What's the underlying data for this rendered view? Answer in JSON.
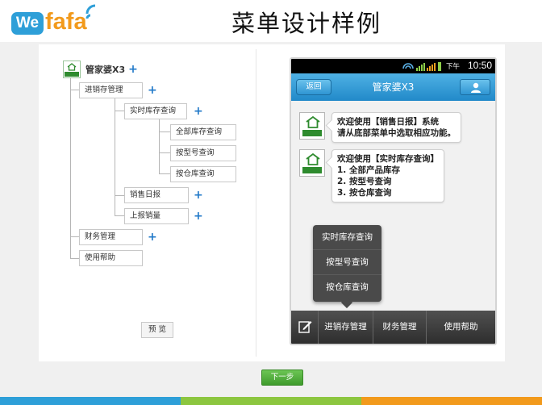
{
  "header": {
    "logo_we": "We",
    "logo_fafa": "fafa",
    "title": "菜单设计样例"
  },
  "editor": {
    "root_name": "管家婆X3",
    "menu_tree": [
      {
        "label": "进销存管理"
      },
      {
        "label": "实时库存查询"
      },
      {
        "label": "全部库存查询"
      },
      {
        "label": "按型号查询"
      },
      {
        "label": "按仓库查询"
      },
      {
        "label": "销售日报"
      },
      {
        "label": "上报销量"
      },
      {
        "label": "财务管理"
      },
      {
        "label": "使用帮助"
      }
    ],
    "preview_label": "预 览"
  },
  "phone": {
    "status_time": "10:50",
    "status_xia": "下午",
    "back_label": "返回",
    "app_title": "管家婆X3",
    "messages": [
      {
        "lines": [
          "欢迎使用【销售日报】系统",
          "请从底部菜单中选取相应功能。"
        ]
      },
      {
        "lines": [
          "欢迎使用【实时库存查询】",
          "1. 全部产品库存",
          "2. 按型号查询",
          "3. 按仓库查询"
        ]
      }
    ],
    "popup_items": [
      "实时库存查询",
      "按型号查询",
      "按仓库查询"
    ],
    "bottom_menu": [
      "进销存管理",
      "财务管理",
      "使用帮助"
    ]
  },
  "next_label": "下一步",
  "colors": {
    "accent_blue": "#2189c9",
    "plus_blue": "#1f78c8",
    "next_green": "#4cae38",
    "strip": [
      "#2e9fd8",
      "#8cc63f",
      "#f29a1c"
    ]
  }
}
